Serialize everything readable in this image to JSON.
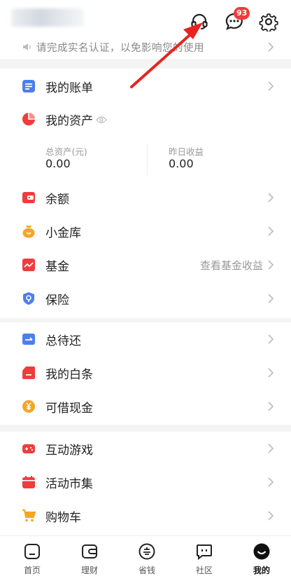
{
  "header": {
    "notification_count": "93",
    "icons": [
      "headset-icon",
      "chat-icon",
      "settings-icon"
    ]
  },
  "notice": {
    "text": "请完成实名认证，以免影响您的使用"
  },
  "menu_groups": [
    {
      "items": [
        {
          "label": "我的账单",
          "icon": "bill-icon"
        },
        {
          "label": "我的资产",
          "icon": "assets-pie-icon"
        }
      ],
      "stats": [
        {
          "label": "总资产(元)",
          "value": "0.00"
        },
        {
          "label": "昨日收益",
          "value": "0.00"
        }
      ]
    },
    {
      "items": [
        {
          "label": "余额",
          "icon": "wallet-icon"
        },
        {
          "label": "小金库",
          "icon": "piggy-bag-icon"
        },
        {
          "label": "基金",
          "icon": "fund-chart-icon",
          "right": "查看基金收益"
        },
        {
          "label": "保险",
          "icon": "insurance-shield-icon"
        }
      ]
    },
    {
      "items": [
        {
          "label": "总待还",
          "icon": "repay-icon"
        },
        {
          "label": "我的白条",
          "icon": "baitiao-card-icon"
        },
        {
          "label": "可借现金",
          "icon": "yen-coin-icon"
        }
      ]
    },
    {
      "items": [
        {
          "label": "互动游戏",
          "icon": "gamepad-icon"
        },
        {
          "label": "活动市集",
          "icon": "calendar-icon"
        },
        {
          "label": "购物车",
          "icon": "cart-icon"
        }
      ]
    }
  ],
  "tabbar": [
    {
      "label": "首页",
      "icon": "home-icon"
    },
    {
      "label": "理财",
      "icon": "finance-wallet-icon"
    },
    {
      "label": "省钱",
      "icon": "save-money-icon"
    },
    {
      "label": "社区",
      "icon": "community-icon"
    },
    {
      "label": "我的",
      "icon": "profile-icon",
      "active": true
    }
  ],
  "colors": {
    "accent_red": "#f03c3c",
    "icon_blue": "#4b7ef0",
    "icon_orange": "#f5a623",
    "annotation_arrow": "#e8231f"
  }
}
